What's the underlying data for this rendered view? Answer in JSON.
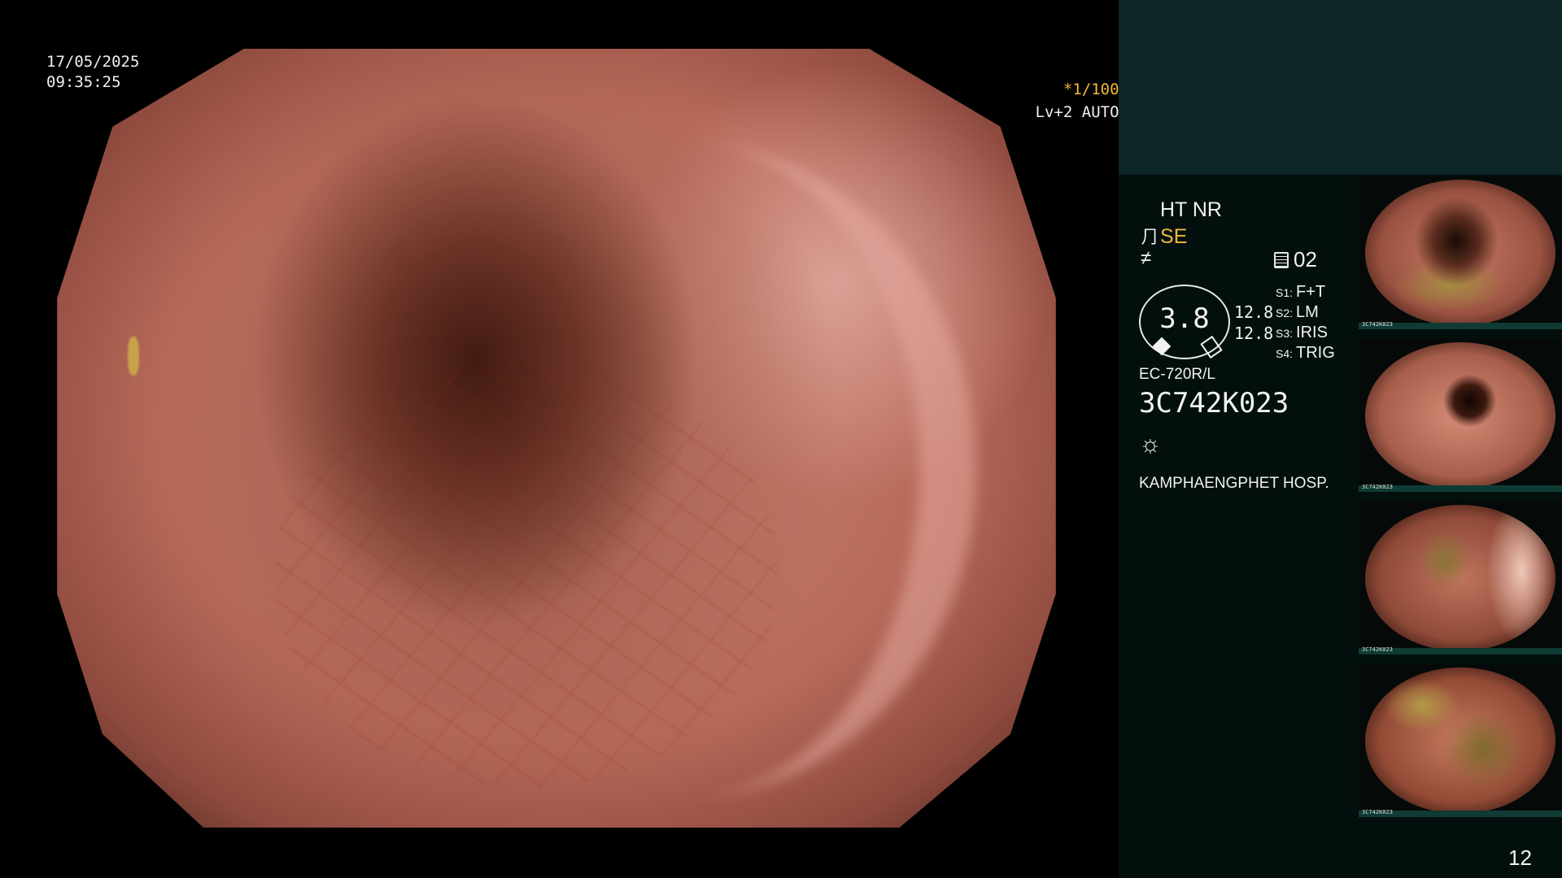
{
  "osd": {
    "date": "17/05/2025",
    "time": "09:35:25",
    "shutter": "*1/100",
    "shutter_icon": "aperture-icon",
    "level": "Lv+2 AUTO",
    "level_icon": "iris-icon"
  },
  "panel": {
    "mode": "HT NR",
    "enhance_icon": "enhance-icon",
    "enhance": "SE",
    "structure_icon": "structure-icon",
    "memory_icon": "memory-icon",
    "memory": "02",
    "dial_value": "3.8",
    "gain_1": "12.8",
    "gain_2": "12.8",
    "switches": [
      {
        "key": "S1:",
        "value": "F+T"
      },
      {
        "key": "S2:",
        "value": "LM"
      },
      {
        "key": "S3:",
        "value": "IRIS"
      },
      {
        "key": "S4:",
        "value": "TRIG"
      }
    ],
    "model": "EC-720R/L",
    "serial": "3C742K023",
    "light_icon": "light-icon",
    "hospital": "KAMPHAENGPHET HOSP.",
    "page_number": "12"
  },
  "thumbnails": [
    {
      "label": "3C742K023"
    },
    {
      "label": "3C742K023"
    },
    {
      "label": "3C742K023"
    },
    {
      "label": "3C742K023"
    }
  ],
  "colors": {
    "osd_highlight": "#f4b73a",
    "panel_bg": "#020f0d",
    "panel_top_bg": "#0d2627"
  }
}
